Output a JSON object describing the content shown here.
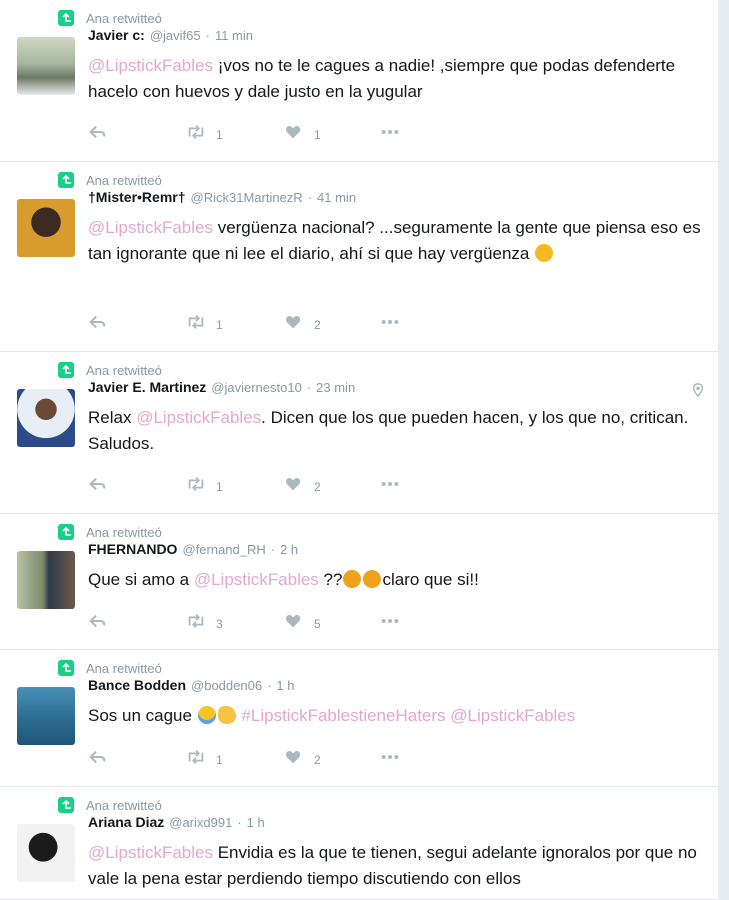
{
  "tweets": [
    {
      "retweet_label": "Ana retwitteó",
      "name": "Javier c:",
      "handle": "@javif65",
      "time": "11 min",
      "segments": [
        {
          "t": "@LipstickFables",
          "m": true
        },
        {
          "t": " ¡vos no te le cagues a nadie! ,siempre que podas defenderte hacelo con huevos y dale justo en la yugular"
        }
      ],
      "retweets": "1",
      "likes": "1"
    },
    {
      "retweet_label": "Ana retwitteó",
      "name": "†Mister•Remr†",
      "handle": "@Rick31MartinezR",
      "time": "41 min",
      "segments": [
        {
          "t": "@LipstickFables",
          "m": true
        },
        {
          "t": " vergüenza nacional? ...seguramente la gente que piensa eso es tan ignorante que ni lee el diario, ahí si que hay vergüenza "
        },
        {
          "e": "confused-face-emoji"
        }
      ],
      "retweets": "1",
      "likes": "2"
    },
    {
      "retweet_label": "Ana retwitteó",
      "name": "Javier E. Martinez",
      "handle": "@javiernesto10",
      "time": "23 min",
      "segments": [
        {
          "t": "Relax "
        },
        {
          "t": "@LipstickFables",
          "m": true
        },
        {
          "t": ". Dicen que los que pueden hacen, y los que no, critican. Saludos."
        }
      ],
      "retweets": "1",
      "likes": "2",
      "has_location": true
    },
    {
      "retweet_label": "Ana retwitteó",
      "name": "FHERNANDO",
      "handle": "@fernand_RH",
      "time": "2 h",
      "segments": [
        {
          "t": "Que si amo a "
        },
        {
          "t": "@LipstickFables",
          "m": true
        },
        {
          "t": " ??"
        },
        {
          "e": "thinking-face-emoji"
        },
        {
          "e": "thinking-face-emoji"
        },
        {
          "t": "claro que si!!"
        }
      ],
      "retweets": "3",
      "likes": "5"
    },
    {
      "retweet_label": "Ana retwitteó",
      "name": "Bance Bodden",
      "handle": "@bodden06",
      "time": "1 h",
      "segments": [
        {
          "t": "Sos un cague "
        },
        {
          "e": "tears-of-joy-emoji"
        },
        {
          "e": "clapping-hands-emoji"
        },
        {
          "t": " "
        },
        {
          "t": "#LipstickFablestieneHaters",
          "m": true
        },
        {
          "t": " "
        },
        {
          "t": "@LipstickFables",
          "m": true
        }
      ],
      "retweets": "1",
      "likes": "2"
    },
    {
      "retweet_label": "Ana retwitteó",
      "name": "Ariana Diaz",
      "handle": "@arixd991",
      "time": "1 h",
      "segments": [
        {
          "t": "@LipstickFables",
          "m": true
        },
        {
          "t": "  Envidia es la que te tienen, segui adelante ignoralos por que no vale la pena estar perdiendo tiempo discutiendo con ellos"
        }
      ],
      "retweets": "",
      "likes": ""
    }
  ],
  "colors": {
    "mention": "#e2a7cf",
    "retweet_icon": "#19cf86",
    "meta": "#8899a6"
  },
  "icons": {
    "reply": "reply-icon",
    "retweet": "retweet-icon",
    "like": "heart-icon",
    "more": "more-dots-icon",
    "location": "location-pin-icon"
  }
}
